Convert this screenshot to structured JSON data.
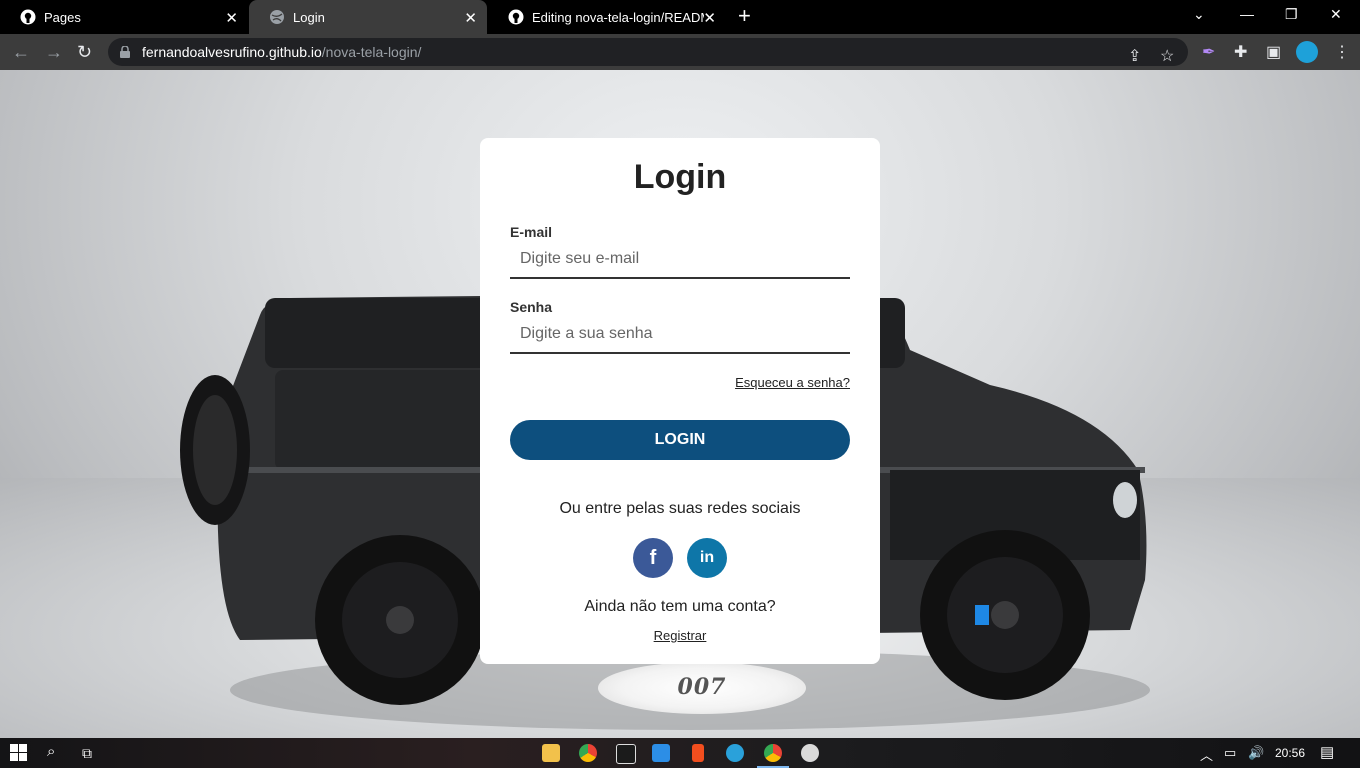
{
  "tabs": [
    {
      "title": "Pages",
      "icon": "github-icon"
    },
    {
      "title": "Login",
      "icon": "globe-icon"
    },
    {
      "title": "Editing nova-tela-login/README",
      "icon": "github-icon"
    }
  ],
  "address": {
    "host": "fernandoalvesrufino.github.io",
    "path": "/nova-tela-login/"
  },
  "login": {
    "title": "Login",
    "email_label": "E-mail",
    "email_placeholder": "Digite seu e-mail",
    "password_label": "Senha",
    "password_placeholder": "Digite a sua senha",
    "forgot": "Esqueceu a senha?",
    "button": "LOGIN",
    "social_text": "Ou entre pelas suas redes sociais",
    "facebook": "f",
    "linkedin": "in",
    "no_account": "Ainda não tem uma conta?",
    "register": "Registrar"
  },
  "background": {
    "spot_text": "007"
  },
  "taskbar": {
    "time": "20:56"
  },
  "colors": {
    "login_button": "#0d4f7e",
    "facebook": "#3b5998",
    "linkedin": "#0e76a8"
  }
}
